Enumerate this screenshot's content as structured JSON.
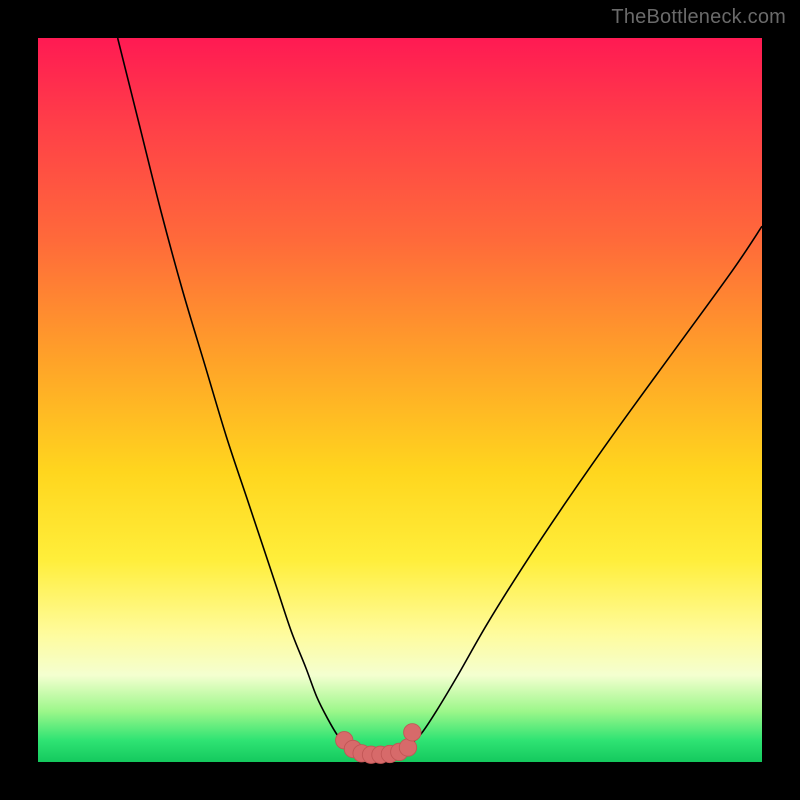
{
  "watermark": "TheBottleneck.com",
  "colors": {
    "background": "#000000",
    "curve": "#000000",
    "marker_fill": "#d76a6a",
    "marker_stroke": "#c15555",
    "gradient_stops": [
      "#ff1a53",
      "#ff6a3a",
      "#ffd61e",
      "#fffb9a",
      "#2fe373"
    ]
  },
  "chart_data": {
    "type": "line",
    "title": "",
    "xlabel": "",
    "ylabel": "",
    "xlim": [
      0,
      100
    ],
    "ylim": [
      0,
      100
    ],
    "grid": false,
    "legend": false,
    "series": [
      {
        "name": "left-branch",
        "x": [
          11,
          14,
          17,
          20,
          23,
          26,
          29,
          31,
          33,
          35,
          37,
          38.5,
          40,
          41.5,
          43
        ],
        "y": [
          100,
          88,
          76,
          65,
          55,
          45,
          36,
          30,
          24,
          18,
          13,
          9,
          6,
          3.5,
          2
        ]
      },
      {
        "name": "right-branch",
        "x": [
          51.5,
          53,
          55,
          58,
          62,
          67,
          73,
          80,
          88,
          96,
          100
        ],
        "y": [
          2.5,
          4,
          7,
          12,
          19,
          27,
          36,
          46,
          57,
          68,
          74
        ]
      }
    ],
    "markers": {
      "name": "bottom-markers",
      "x": [
        42.3,
        43.5,
        44.7,
        46.0,
        47.3,
        48.6,
        49.9,
        51.1,
        51.7
      ],
      "y": [
        3.0,
        1.8,
        1.2,
        1.0,
        1.0,
        1.1,
        1.4,
        2.0,
        4.1
      ],
      "radius": 1.2
    }
  }
}
